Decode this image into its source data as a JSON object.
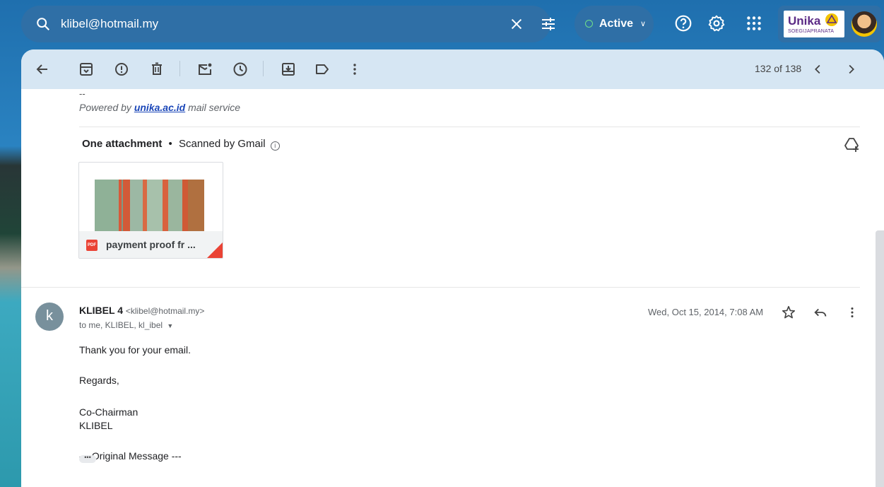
{
  "search": {
    "query": "klibel@hotmail.my"
  },
  "status": {
    "label": "Active"
  },
  "logo": {
    "brand": "Unika",
    "sub": "SOEGIJAPRANATA"
  },
  "pager": {
    "text": "132 of 138"
  },
  "prev_message": {
    "sig_dashes": "--",
    "powered_prefix": "Powered by",
    "powered_link": "unika.ac.id",
    "powered_suffix": "mail service"
  },
  "attachments": {
    "count_label": "One attachment",
    "separator": "•",
    "scan_label": "Scanned by Gmail",
    "file_type": "PDF",
    "file_name": "payment proof fr ..."
  },
  "message": {
    "avatar_letter": "k",
    "sender_name": "KLIBEL 4",
    "sender_email": "<klibel@hotmail.my>",
    "recipients": "to me, KLIBEL, kl_ibel",
    "date": "Wed, Oct 15, 2014, 7:08 AM",
    "lines": [
      "Thank you for your email.",
      "Regards,",
      "Co-Chairman",
      "KLIBEL",
      "--- Original Message ---"
    ],
    "more_label": "•••"
  },
  "colors": {
    "toolbar_bg": "#d6e6f3",
    "search_bg": "#2f6fa6",
    "link": "#1a46b8",
    "pdf_red": "#ea4335",
    "avatar_grey": "#78909c",
    "active_green": "#6fe08a"
  },
  "icons": {
    "toolbar": [
      "back-arrow-icon",
      "archive-icon",
      "report-spam-icon",
      "delete-icon",
      "mark-unread-icon",
      "snooze-icon",
      "add-to-tasks-icon",
      "label-icon",
      "more-vert-icon"
    ],
    "top": [
      "search-icon",
      "clear-icon",
      "tune-icon",
      "help-icon",
      "settings-icon",
      "apps-grid-icon"
    ]
  }
}
